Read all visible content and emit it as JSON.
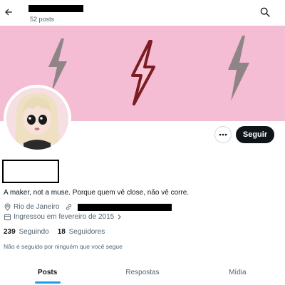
{
  "header": {
    "posts_count": "52 posts"
  },
  "profile": {
    "bio": "A maker, not a muse. Porque quem vê close, não vê corre.",
    "location": "Rio de Janeiro",
    "joined": "Ingressou em fevereiro de 2015",
    "following_count": "239",
    "following_label": "Seguindo",
    "followers_count": "18",
    "followers_label": "Seguidores",
    "not_followed_note": "Não é seguido por ninguém que você segue"
  },
  "actions": {
    "follow_label": "Seguir"
  },
  "tabs": [
    {
      "label": "Posts",
      "active": true
    },
    {
      "label": "Respostas",
      "active": false
    },
    {
      "label": "Mídia",
      "active": false
    }
  ],
  "colors": {
    "banner": "#f4bdd4",
    "bolt_gray": "#8f8486",
    "bolt_red": "#7a1c22",
    "tab_accent": "#1d9bf0"
  },
  "icons": {
    "back": "arrow-left-icon",
    "search": "search-icon",
    "more": "more-horizontal-icon",
    "location": "location-pin-icon",
    "link": "link-icon",
    "calendar": "calendar-icon"
  }
}
